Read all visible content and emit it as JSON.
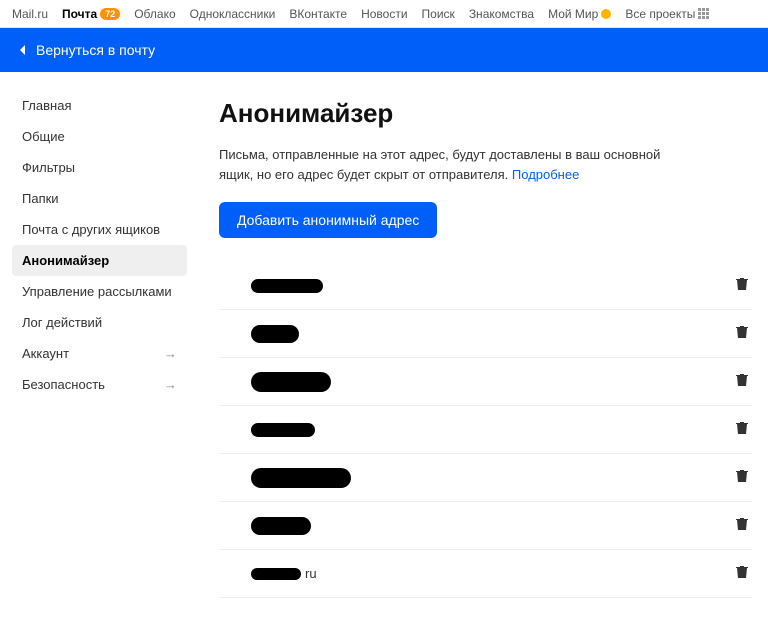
{
  "topnav": {
    "items": [
      {
        "label": "Mail.ru",
        "name": "topnav-mailru"
      },
      {
        "label": "Почта",
        "name": "topnav-mail",
        "badge_orange": "72",
        "active": true
      },
      {
        "label": "Облако",
        "name": "topnav-cloud"
      },
      {
        "label": "Одноклассники",
        "name": "topnav-ok"
      },
      {
        "label": "ВКонтакте",
        "name": "topnav-vk"
      },
      {
        "label": "Новости",
        "name": "topnav-news"
      },
      {
        "label": "Поиск",
        "name": "topnav-search"
      },
      {
        "label": "Знакомства",
        "name": "topnav-dating"
      },
      {
        "label": "Мой Мир",
        "name": "topnav-mymir",
        "badge_yellow": true
      },
      {
        "label": "Все проекты",
        "name": "topnav-allprojects",
        "grid": true
      }
    ]
  },
  "bluebar": {
    "back_label": "Вернуться в почту"
  },
  "sidebar": {
    "items": [
      {
        "label": "Главная",
        "name": "sidebar-home"
      },
      {
        "label": "Общие",
        "name": "sidebar-general"
      },
      {
        "label": "Фильтры",
        "name": "sidebar-filters"
      },
      {
        "label": "Папки",
        "name": "sidebar-folders"
      },
      {
        "label": "Почта с других ящиков",
        "name": "sidebar-external"
      },
      {
        "label": "Анонимайзер",
        "name": "sidebar-anonymizer",
        "selected": true
      },
      {
        "label": "Управление рассылками",
        "name": "sidebar-subscriptions"
      },
      {
        "label": "Лог действий",
        "name": "sidebar-log"
      },
      {
        "label": "Аккаунт",
        "name": "sidebar-account",
        "arrow": true
      },
      {
        "label": "Безопасность",
        "name": "sidebar-security",
        "arrow": true
      }
    ]
  },
  "main": {
    "title": "Анонимайзер",
    "description": "Письма, отправленные на этот адрес, будут доставлены в ваш основной ящик, но его адрес будет скрыт от отправителя.",
    "more_link": "Подробнее",
    "add_button": "Добавить анонимный адрес",
    "addresses": [
      {
        "redacted_w": 72,
        "redacted_h": 14
      },
      {
        "redacted_w": 48,
        "redacted_h": 18
      },
      {
        "redacted_w": 80,
        "redacted_h": 20
      },
      {
        "redacted_w": 64,
        "redacted_h": 14
      },
      {
        "redacted_w": 100,
        "redacted_h": 20
      },
      {
        "redacted_w": 60,
        "redacted_h": 18
      },
      {
        "redacted_w": 50,
        "redacted_h": 12,
        "suffix": "ru"
      }
    ]
  }
}
